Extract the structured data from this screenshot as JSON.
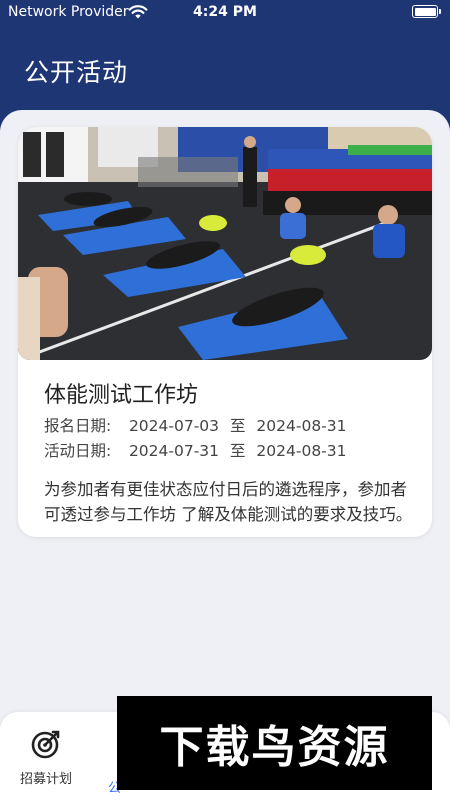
{
  "status_bar": {
    "carrier": "Network Provider",
    "time": "4:24 PM",
    "wifi_icon": "wifi-icon",
    "battery_icon": "battery-full-icon"
  },
  "header": {
    "title": "公开活动",
    "background_color": "#1f3675"
  },
  "event": {
    "image_alt": "体能测试工作坊",
    "title": "体能测试工作坊",
    "registration": {
      "label": "报名日期:",
      "start": "2024-07-03",
      "separator": "至",
      "end": "2024-08-31"
    },
    "activity": {
      "label": "活动日期:",
      "start": "2024-07-31",
      "separator": "至",
      "end": "2024-08-31"
    },
    "description": "为参加者有更佳状态应付日后的遴选程序，参加者可透过参与工作坊 了解及体能测试的要求及技巧。"
  },
  "tab_bar": {
    "tabs": [
      {
        "label": "招募计划",
        "icon": "target-icon",
        "active": false
      },
      {
        "label": "公",
        "icon": "",
        "active": true
      }
    ],
    "active_color": "#3a6df0"
  },
  "watermark": {
    "text": "下载鸟资源"
  }
}
